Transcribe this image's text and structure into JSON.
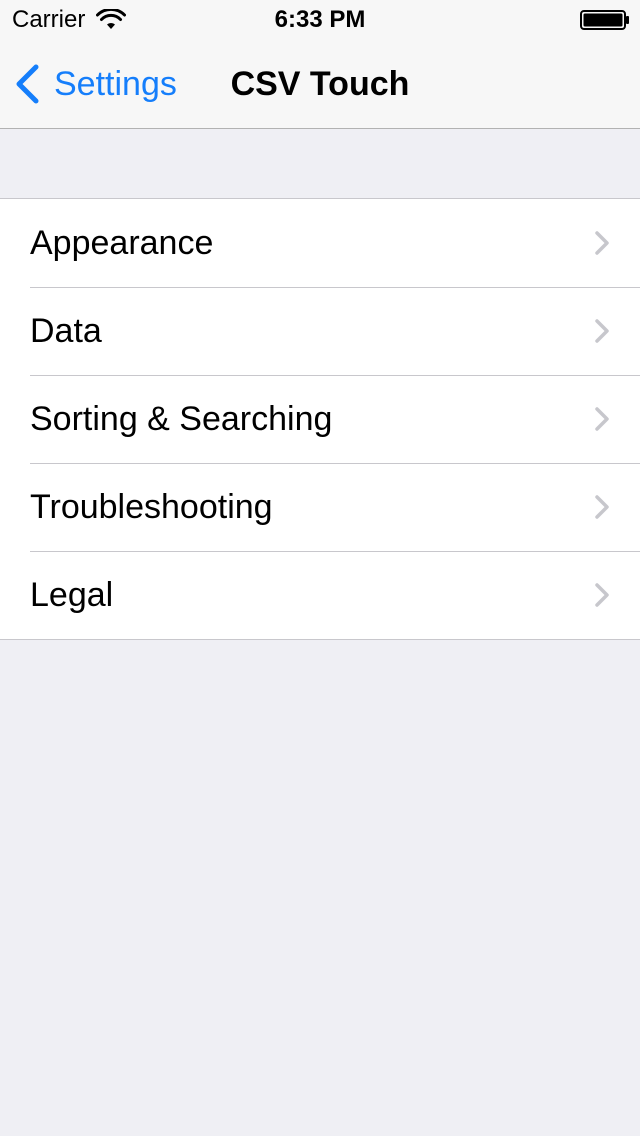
{
  "status_bar": {
    "carrier": "Carrier",
    "time": "6:33 PM",
    "icons": [
      "wifi-icon",
      "battery-icon"
    ]
  },
  "nav_bar": {
    "back_label": "Settings",
    "title": "CSV Touch",
    "accent_color": "#157efb"
  },
  "menu": {
    "items": [
      {
        "label": "Appearance",
        "icon": "chevron-right-icon"
      },
      {
        "label": "Data",
        "icon": "chevron-right-icon"
      },
      {
        "label": "Sorting & Searching",
        "icon": "chevron-right-icon"
      },
      {
        "label": "Troubleshooting",
        "icon": "chevron-right-icon"
      },
      {
        "label": "Legal",
        "icon": "chevron-right-icon"
      }
    ]
  }
}
